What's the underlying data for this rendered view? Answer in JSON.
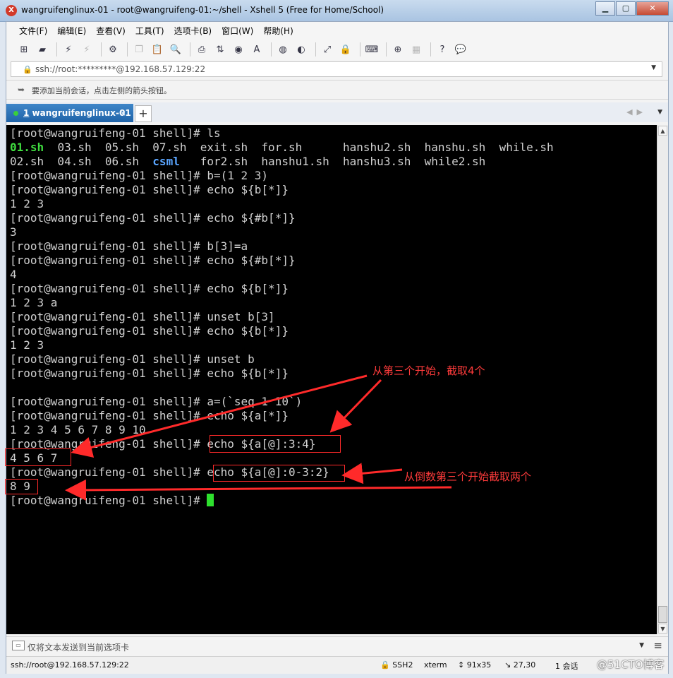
{
  "window": {
    "title": "wangruifenglinux-01 - root@wangruifeng-01:~/shell - Xshell 5 (Free for Home/School)",
    "minimize": "▁",
    "maximize": "▢",
    "close": "✕"
  },
  "menu": [
    "文件(F)",
    "编辑(E)",
    "查看(V)",
    "工具(T)",
    "选项卡(B)",
    "窗口(W)",
    "帮助(H)"
  ],
  "toolbar": {
    "icons": [
      "new-session-icon",
      "open-folder-icon",
      "reconnect-icon",
      "disconnect-icon",
      "properties-icon",
      "copy-icon",
      "paste-icon",
      "find-icon",
      "print-icon",
      "transfer-icon",
      "globe-icon",
      "font-icon",
      "xftp-icon",
      "xagent-icon",
      "fullscreen-icon",
      "lock-icon",
      "keyboard-icon",
      "add-tab-icon",
      "layout-icon",
      "help-icon",
      "chat-icon"
    ]
  },
  "address": {
    "value": "ssh://root:*********@192.168.57.129:22"
  },
  "hint": {
    "text": "要添加当前会话，点击左侧的箭头按钮。"
  },
  "tabs": [
    {
      "number": "1",
      "label": "wangruifenglinux-01",
      "close": "×"
    }
  ],
  "tab_add": "+",
  "terminal": {
    "prompt": "[root@wangruifeng-01 shell]# ",
    "ls_row1": [
      {
        "text": "01.sh",
        "style": "g"
      },
      {
        "text": "  03.sh  05.sh  07.sh  exit.sh  for.sh      hanshu2.sh  hanshu.sh  while.sh",
        "style": ""
      }
    ],
    "ls_row2": [
      {
        "text": "02.sh  04.sh  06.sh  ",
        "style": ""
      },
      {
        "text": "csml",
        "style": "b"
      },
      {
        "text": "   for2.sh  hanshu1.sh  hanshu3.sh  while2.sh",
        "style": ""
      }
    ],
    "lines": [
      {
        "kind": "cmd",
        "text": "ls"
      },
      {
        "kind": "ls1"
      },
      {
        "kind": "ls2"
      },
      {
        "kind": "cmd",
        "text": "b=(1 2 3)"
      },
      {
        "kind": "cmd",
        "text": "echo ${b[*]}"
      },
      {
        "kind": "out",
        "text": "1 2 3"
      },
      {
        "kind": "cmd",
        "text": "echo ${#b[*]}"
      },
      {
        "kind": "out",
        "text": "3"
      },
      {
        "kind": "cmd",
        "text": "b[3]=a"
      },
      {
        "kind": "cmd",
        "text": "echo ${#b[*]}"
      },
      {
        "kind": "out",
        "text": "4"
      },
      {
        "kind": "cmd",
        "text": "echo ${b[*]}"
      },
      {
        "kind": "out",
        "text": "1 2 3 a"
      },
      {
        "kind": "cmd",
        "text": "unset b[3]"
      },
      {
        "kind": "cmd",
        "text": "echo ${b[*]}"
      },
      {
        "kind": "out",
        "text": "1 2 3"
      },
      {
        "kind": "cmd",
        "text": "unset b"
      },
      {
        "kind": "cmd",
        "text": "echo ${b[*]}"
      },
      {
        "kind": "out",
        "text": ""
      },
      {
        "kind": "cmd",
        "text": "a=(`seq 1 10`)"
      },
      {
        "kind": "cmd",
        "text": "echo ${a[*]}"
      },
      {
        "kind": "out",
        "text": "1 2 3 4 5 6 7 8 9 10"
      },
      {
        "kind": "cmd",
        "text": "echo ${a[@]:3:4}"
      },
      {
        "kind": "out",
        "text": "4 5 6 7"
      },
      {
        "kind": "cmd",
        "text": "echo ${a[@]:0-3:2}"
      },
      {
        "kind": "out",
        "text": "8 9"
      },
      {
        "kind": "cursor"
      }
    ]
  },
  "annotations": {
    "note1": "从第三个开始，截取4个",
    "note2": "从倒数第三个开始截取两个",
    "color": "#ff2a2a"
  },
  "send_bar": {
    "text": "仅将文本发送到当前选项卡"
  },
  "status": {
    "connection": "ssh://root@192.168.57.129:22",
    "protocol": "SSH2",
    "term": "xterm",
    "size": "91x35",
    "pos": "27,30",
    "sessions": "1 会话"
  },
  "watermark": "@51CTO博客"
}
